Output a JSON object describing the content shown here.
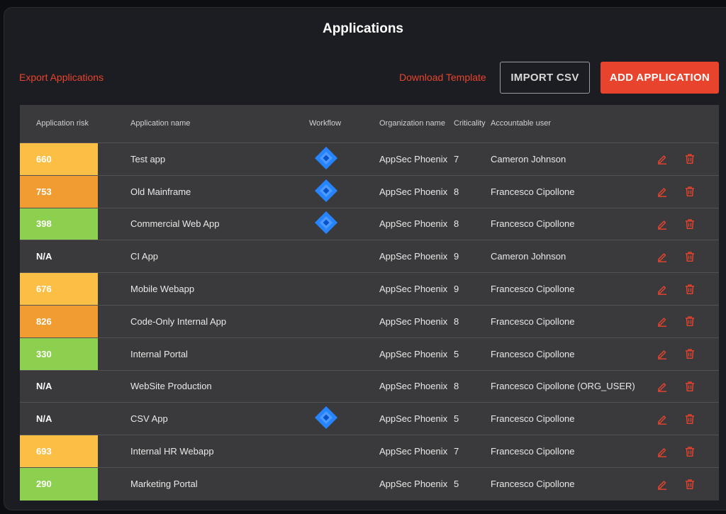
{
  "page": {
    "title": "Applications"
  },
  "toolbar": {
    "export_label": "Export Applications",
    "download_label": "Download Template",
    "import_label": "IMPORT CSV",
    "add_label": "ADD APPLICATION"
  },
  "colors": {
    "accent": "#e8432d",
    "risk_high": "#f19c30",
    "risk_medium": "#fbbf45",
    "risk_low": "#8dcf4e",
    "workflow_icon": "#2684ff"
  },
  "table": {
    "columns": [
      "Application risk",
      "Application name",
      "Workflow",
      "Organization name",
      "Criticality",
      "Accountable user"
    ],
    "rows": [
      {
        "risk": "660",
        "risk_level": "medium",
        "name": "Test app",
        "workflow": "jira-icon",
        "org": "AppSec Phoenix",
        "criticality": "7",
        "user": "Cameron Johnson"
      },
      {
        "risk": "753",
        "risk_level": "high",
        "name": "Old Mainframe",
        "workflow": "jira-icon",
        "org": "AppSec Phoenix",
        "criticality": "8",
        "user": "Francesco Cipollone"
      },
      {
        "risk": "398",
        "risk_level": "low",
        "name": "Commercial Web App",
        "workflow": "jira-icon",
        "org": "AppSec Phoenix",
        "criticality": "8",
        "user": "Francesco Cipollone"
      },
      {
        "risk": "N/A",
        "risk_level": "none",
        "name": "CI App",
        "workflow": "",
        "org": "AppSec Phoenix",
        "criticality": "9",
        "user": "Cameron Johnson"
      },
      {
        "risk": "676",
        "risk_level": "medium",
        "name": "Mobile Webapp",
        "workflow": "",
        "org": "AppSec Phoenix",
        "criticality": "9",
        "user": "Francesco Cipollone"
      },
      {
        "risk": "826",
        "risk_level": "high",
        "name": "Code-Only Internal App",
        "workflow": "",
        "org": "AppSec Phoenix",
        "criticality": "8",
        "user": "Francesco Cipollone"
      },
      {
        "risk": "330",
        "risk_level": "low",
        "name": "Internal Portal",
        "workflow": "",
        "org": "AppSec Phoenix",
        "criticality": "5",
        "user": "Francesco Cipollone"
      },
      {
        "risk": "N/A",
        "risk_level": "none",
        "name": "WebSite Production",
        "workflow": "",
        "org": "AppSec Phoenix",
        "criticality": "8",
        "user": "Francesco Cipollone (ORG_USER)"
      },
      {
        "risk": "N/A",
        "risk_level": "none",
        "name": "CSV App",
        "workflow": "jira-icon",
        "org": "AppSec Phoenix",
        "criticality": "5",
        "user": "Francesco Cipollone"
      },
      {
        "risk": "693",
        "risk_level": "medium",
        "name": "Internal HR Webapp",
        "workflow": "",
        "org": "AppSec Phoenix",
        "criticality": "7",
        "user": "Francesco Cipollone"
      },
      {
        "risk": "290",
        "risk_level": "low",
        "name": "Marketing Portal",
        "workflow": "",
        "org": "AppSec Phoenix",
        "criticality": "5",
        "user": "Francesco Cipollone"
      }
    ],
    "row_actions": [
      "edit-icon",
      "trash-icon"
    ]
  }
}
